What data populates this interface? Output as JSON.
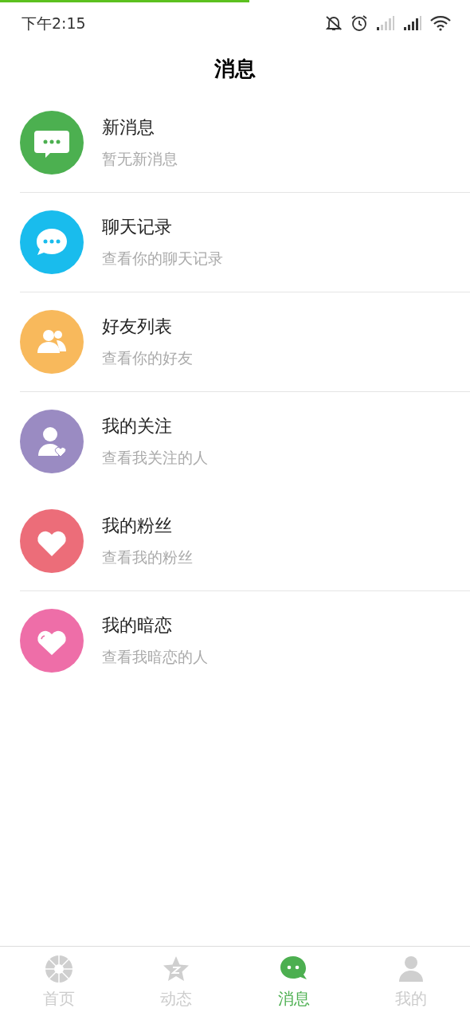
{
  "status_bar": {
    "time": "下午2:15"
  },
  "header": {
    "title": "消息"
  },
  "items": [
    {
      "kind": "chat-square",
      "color": "#4cb050",
      "title": "新消息",
      "subtitle": "暂无新消息",
      "divider": true
    },
    {
      "kind": "chat-round",
      "color": "#19bced",
      "title": "聊天记录",
      "subtitle": "查看你的聊天记录",
      "divider": true
    },
    {
      "kind": "people",
      "color": "#f8b95c",
      "title": "好友列表",
      "subtitle": "查看你的好友",
      "divider": true
    },
    {
      "kind": "person-heart",
      "color": "#9a8bc2",
      "title": "我的关注",
      "subtitle": "查看我关注的人",
      "divider": false
    },
    {
      "kind": "heart",
      "color": "#ec6d79",
      "title": "我的粉丝",
      "subtitle": "查看我的粉丝",
      "divider": true
    },
    {
      "kind": "heart-shine",
      "color": "#ee6ea8",
      "title": "我的暗恋",
      "subtitle": "查看我暗恋的人",
      "divider": false
    }
  ],
  "tabs": [
    {
      "kind": "aperture",
      "label": "首页",
      "selected": false
    },
    {
      "kind": "star",
      "label": "动态",
      "selected": false
    },
    {
      "kind": "chat",
      "label": "消息",
      "selected": true
    },
    {
      "kind": "person",
      "label": "我的",
      "selected": false
    }
  ]
}
